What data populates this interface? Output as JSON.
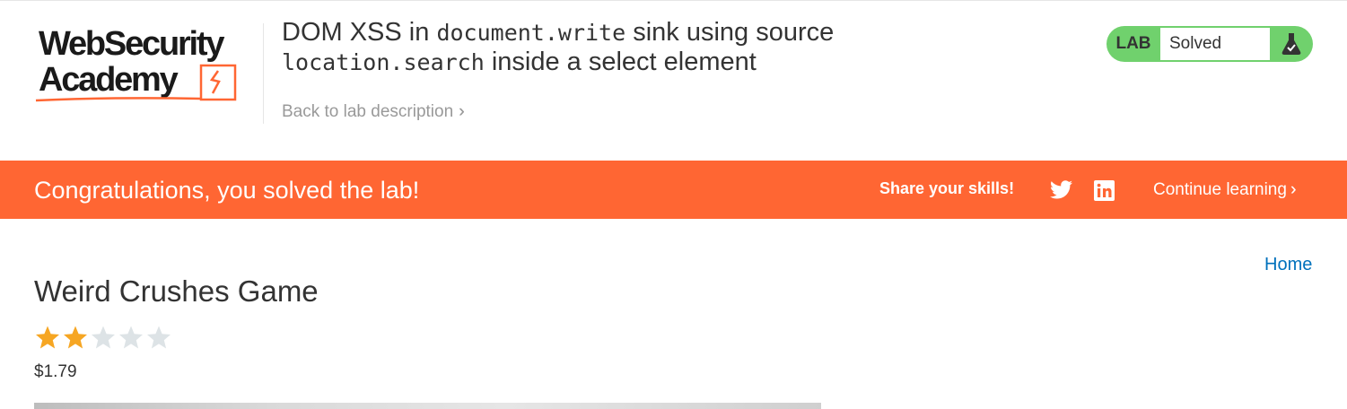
{
  "logo": {
    "line1": "WebSecurity",
    "line2": "Academy"
  },
  "header": {
    "title_parts": [
      "DOM XSS in ",
      "document.write",
      " sink using source ",
      "location.search",
      " inside a select element"
    ],
    "back_link": "Back to lab description"
  },
  "lab_status": {
    "label": "LAB",
    "state": "Solved",
    "icon": "flask-icon"
  },
  "banner": {
    "message": "Congratulations, you solved the lab!",
    "share_label": "Share your skills!",
    "continue_label": "Continue learning",
    "icons": [
      "twitter-icon",
      "linkedin-icon"
    ]
  },
  "nav": {
    "home": "Home"
  },
  "product": {
    "title": "Weird Crushes Game",
    "rating": 2,
    "rating_max": 5,
    "price": "$1.79"
  },
  "colors": {
    "accent": "#ff6633",
    "status_green": "#70d16d",
    "link": "#0071bc",
    "star_filled": "#f6a623",
    "star_empty": "#dde3e6"
  }
}
